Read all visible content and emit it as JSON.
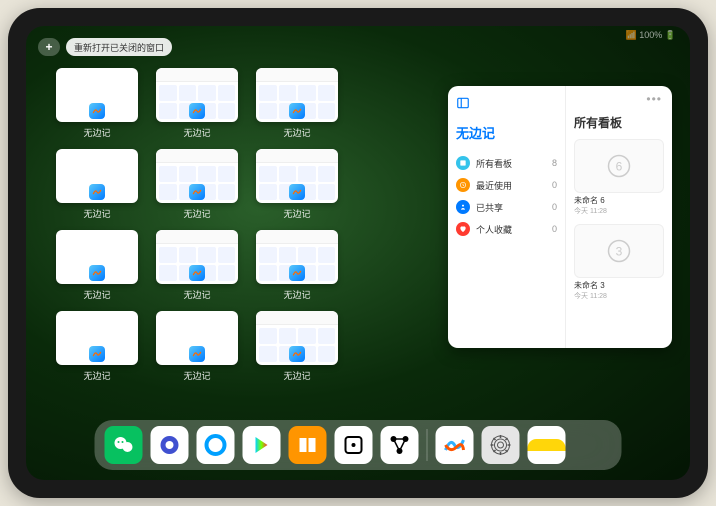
{
  "status": {
    "indicators": "📶 100% 🔋"
  },
  "topbar": {
    "plus": "+",
    "reopen_label": "重新打开已关闭的窗口"
  },
  "app_name": "无边记",
  "thumbnails": [
    {
      "label": "无边记",
      "style": "blank"
    },
    {
      "label": "无边记",
      "style": "detail"
    },
    {
      "label": "无边记",
      "style": "detail"
    },
    {
      "label": "无边记",
      "style": "blank"
    },
    {
      "label": "无边记",
      "style": "detail"
    },
    {
      "label": "无边记",
      "style": "detail"
    },
    {
      "label": "无边记",
      "style": "blank"
    },
    {
      "label": "无边记",
      "style": "detail"
    },
    {
      "label": "无边记",
      "style": "detail"
    },
    {
      "label": "无边记",
      "style": "blank"
    },
    {
      "label": "无边记",
      "style": "blank"
    },
    {
      "label": "无边记",
      "style": "detail"
    }
  ],
  "panel": {
    "left_title": "无边记",
    "right_title": "所有看板",
    "nav": [
      {
        "icon_color": "#34c3eb",
        "label": "所有看板",
        "count": "8"
      },
      {
        "icon_color": "#ff9500",
        "label": "最近使用",
        "count": "0"
      },
      {
        "icon_color": "#007aff",
        "label": "已共享",
        "count": "0"
      },
      {
        "icon_color": "#ff3b30",
        "label": "个人收藏",
        "count": "0"
      }
    ],
    "boards": [
      {
        "name": "未命名 6",
        "date": "今天 11:28",
        "digit": "6"
      },
      {
        "name": "未命名 3",
        "date": "今天 11:28",
        "digit": "3"
      }
    ]
  },
  "dock": {
    "apps": [
      {
        "name": "wechat",
        "bg": "#07c160"
      },
      {
        "name": "quark",
        "bg": "#ffffff"
      },
      {
        "name": "qq-browser",
        "bg": "#ffffff"
      },
      {
        "name": "play",
        "bg": "#ffffff"
      },
      {
        "name": "books",
        "bg": "#ff9500"
      },
      {
        "name": "dice",
        "bg": "#ffffff"
      },
      {
        "name": "node",
        "bg": "#ffffff"
      },
      {
        "name": "freeform",
        "bg": "#ffffff"
      },
      {
        "name": "settings",
        "bg": "#e5e5e5"
      },
      {
        "name": "notes",
        "bg": "#ffffff"
      },
      {
        "name": "folder",
        "bg": "transparent"
      }
    ]
  }
}
